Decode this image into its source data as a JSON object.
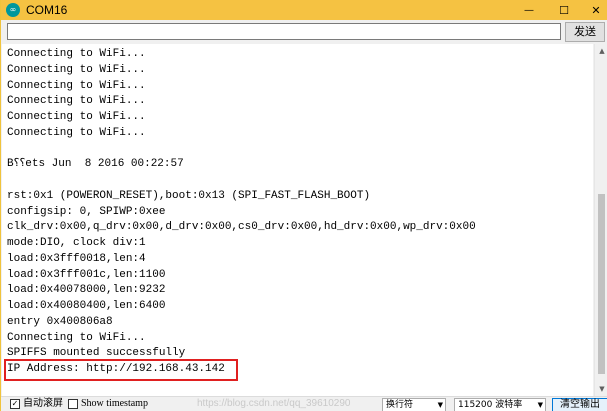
{
  "window": {
    "title": "COM16",
    "minimize_glyph": "—",
    "maximize_glyph": "☐",
    "close_glyph": "✕",
    "app_icon_glyph": "∞",
    "app_icon_color": "#00979c",
    "titlebar_color": "#f5c242"
  },
  "send_row": {
    "input_value": "",
    "send_label": "发送"
  },
  "output": {
    "lines": [
      "Connecting to WiFi...",
      "Connecting to WiFi...",
      "Connecting to WiFi...",
      "Connecting to WiFi...",
      "Connecting to WiFi...",
      "Connecting to WiFi...",
      "",
      "B⸮⸮ets Jun  8 2016 00:22:57",
      "",
      "rst:0x1 (POWERON_RESET),boot:0x13 (SPI_FAST_FLASH_BOOT)",
      "configsip: 0, SPIWP:0xee",
      "clk_drv:0x00,q_drv:0x00,d_drv:0x00,cs0_drv:0x00,hd_drv:0x00,wp_drv:0x00",
      "mode:DIO, clock div:1",
      "load:0x3fff0018,len:4",
      "load:0x3fff001c,len:1100",
      "load:0x40078000,len:9232",
      "load:0x40080400,len:6400",
      "entry 0x400806a8",
      "Connecting to WiFi...",
      "SPIFFS mounted successfully",
      "IP Address: http://192.168.43.142"
    ],
    "highlight_color": "#e02020"
  },
  "bottom_bar": {
    "autoscroll_checked_glyph": "✓",
    "autoscroll_label": "自动滚屏",
    "timestamp_label": "Show timestamp",
    "watermark_text": "https://blog.csdn.net/qq_39610290",
    "line_ending": "换行符",
    "baud_rate": "115200 波特率",
    "clear_label": "清空输出",
    "dropdown_glyph": "▼"
  }
}
